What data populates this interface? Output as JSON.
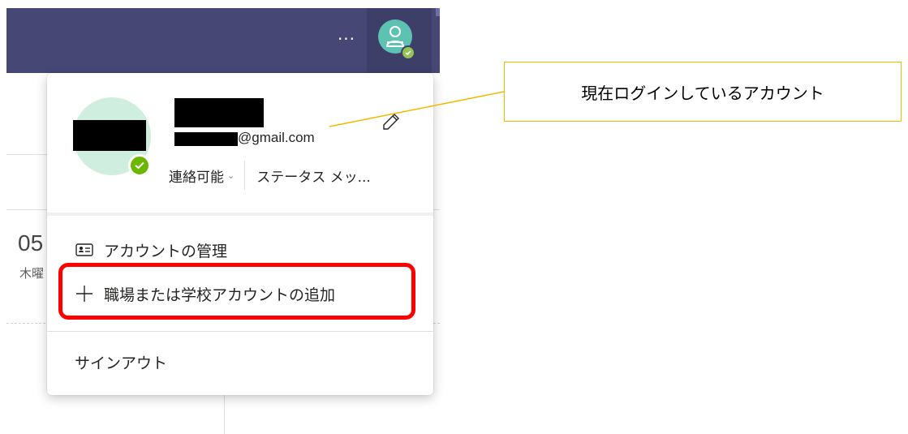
{
  "topbar": {
    "more_label": "···",
    "avatar_icon": "person-icon",
    "status_icon": "checkmark-icon"
  },
  "background": {
    "date_fragment": "05",
    "day_fragment": "木曜"
  },
  "profile": {
    "email_suffix": "@gmail.com",
    "presence": "連絡可能",
    "status_message": "ステータス メッ..."
  },
  "menu": {
    "manage_account": "アカウントの管理",
    "add_account": "職場または学校アカウントの追加",
    "sign_out": "サインアウト"
  },
  "annotation": {
    "callout_text": "現在ログインしているアカウント",
    "callout_border_color": "#f4b800",
    "highlight_color": "#ff0000"
  },
  "colors": {
    "appbar": "#464775",
    "avatar_bg": "#5ec2b3",
    "profile_avatar_bg": "#cfeee0",
    "status_green": "#6bb700"
  }
}
